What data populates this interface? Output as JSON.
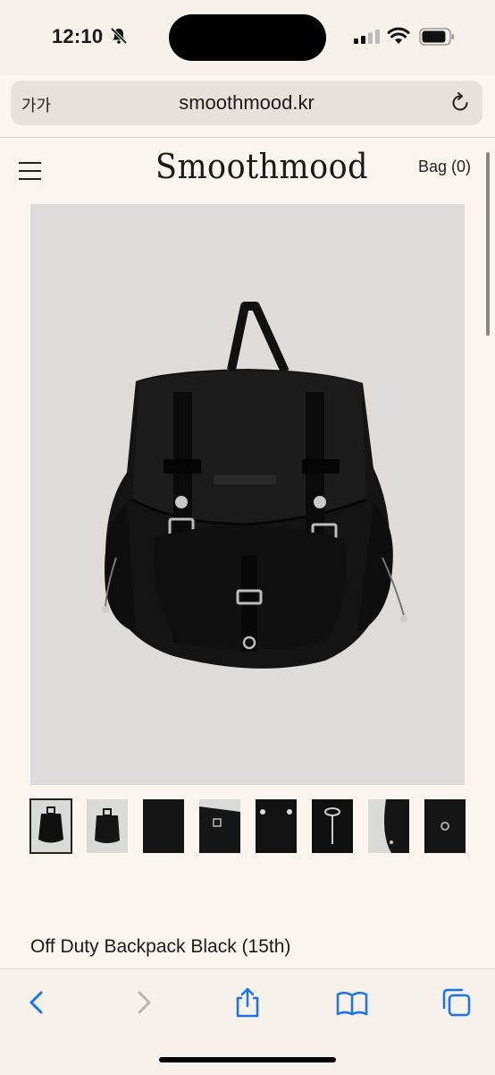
{
  "status_bar": {
    "time": "12:10"
  },
  "browser": {
    "text_size_label": "가가",
    "url": "smoothmood.kr"
  },
  "site": {
    "logo": "Smoothmood",
    "bag_label": "Bag (0)"
  },
  "product": {
    "title": "Off Duty Backpack Black (15th)",
    "thumbnails": [
      "view-1",
      "view-2",
      "view-3",
      "view-4",
      "view-5",
      "view-6",
      "view-7",
      "view-8"
    ],
    "selected_thumbnail": 0
  },
  "colors": {
    "page_bg": "#faf5ef",
    "image_bg": "#dddcda",
    "accent_blue": "#1a73e8"
  },
  "icons": [
    "bell-slash-icon",
    "signal-icon",
    "wifi-icon",
    "battery-icon",
    "reload-icon",
    "hamburger-icon",
    "back-icon",
    "forward-icon",
    "share-icon",
    "bookmarks-icon",
    "tabs-icon"
  ]
}
